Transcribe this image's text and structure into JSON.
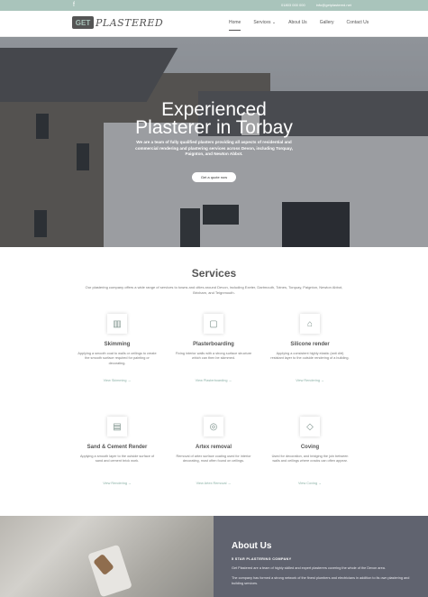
{
  "topbar": {
    "social_icon": "facebook-icon",
    "phone": "01803 000 000",
    "email": "info@getplastered.net"
  },
  "nav": {
    "logo_badge": "GET",
    "logo_text": "PLASTERED",
    "items": [
      {
        "label": "Home"
      },
      {
        "label": "Services ⌄"
      },
      {
        "label": "About Us"
      },
      {
        "label": "Gallery"
      },
      {
        "label": "Contact Us"
      }
    ]
  },
  "hero": {
    "title_line1": "Experienced",
    "title_line2": "Plasterer in Torbay",
    "subtitle": "We are a team of fully qualified plasters providing all aspects of residential and commercial rendering and plastering services across Devon, including Torquay, Paignton, and Newton Abbot.",
    "cta": "Get a quote now"
  },
  "services": {
    "title": "Services",
    "intro": "Our plastering company offers a wide range of services to towns and cities around Devon, including Exeter, Dartmouth, Totnes, Torquay, Paignton, Newton Abbot, Brixham, and Teignmouth.",
    "items": [
      {
        "icon": "skimming-icon",
        "glyph": "▥",
        "title": "Skimming",
        "desc": "Applying a smooth coat to walls or ceilings to create the smooth surface required for painting or decorating.",
        "more": "View Skimming →"
      },
      {
        "icon": "plasterboarding-icon",
        "glyph": "▢",
        "title": "Plasterboarding",
        "desc": "Fixing interior walls with a strong surface structure which can then be skimmed.",
        "more": "View Plasterboarding →"
      },
      {
        "icon": "house-icon",
        "glyph": "⌂",
        "title": "Silicone render",
        "desc": "Applying a consistent highly elastic (anti dirt) resistant layer to the outside rendering of a building.",
        "more": "View Rendering →"
      },
      {
        "icon": "render-icon",
        "glyph": "▤",
        "title": "Sand & Cement Render",
        "desc": "Applying a smooth layer to the outside surface of sand and cement brick work.",
        "more": "View Rendering →"
      },
      {
        "icon": "artex-icon",
        "glyph": "◎",
        "title": "Artex removal",
        "desc": "Removal of artex surface coating used for interior decorating, most often found on ceilings.",
        "more": "View Artex Removal →"
      },
      {
        "icon": "coving-icon",
        "glyph": "◇",
        "title": "Coving",
        "desc": "Used for decoration, and bridging the join between walls and ceilings where cracks can often appear.",
        "more": "View Coving →"
      }
    ]
  },
  "about": {
    "title": "About Us",
    "subtitle": "5 STAR PLASTERING COMPANY",
    "p1": "Get Plastered are a team of highly skilled and expert plasterers covering the whole of the Devon area.",
    "p2": "The company has formed a strong network of the finest plumbers and electricians in addition to its own plastering and building services."
  },
  "colors": {
    "accent": "#a9c4bb",
    "about_panel": "#60636f"
  }
}
